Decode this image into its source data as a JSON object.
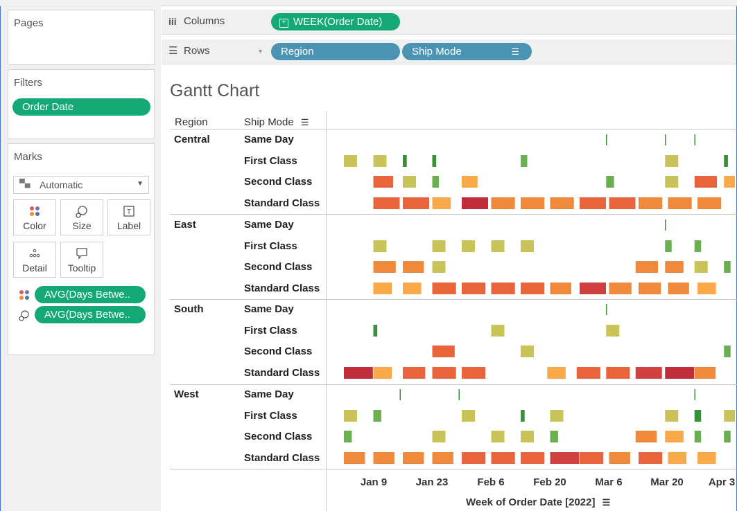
{
  "pages_label": "Pages",
  "filters": {
    "title": "Filters",
    "pill": "Order Date"
  },
  "marks": {
    "title": "Marks",
    "type_select": "Automatic",
    "buttons": [
      "Color",
      "Size",
      "Label",
      "Detail",
      "Tooltip"
    ],
    "pills": [
      "AVG(Days Betwe..",
      "AVG(Days Betwe.."
    ]
  },
  "columns_shelf": {
    "label": "Columns",
    "pill": "WEEK(Order Date)"
  },
  "rows_shelf": {
    "label": "Rows",
    "pills": [
      "Region",
      "Ship Mode"
    ]
  },
  "colors": {
    "pill_green": "#14a875",
    "pill_blue": "#4a93b3",
    "green": "#3a8f3a",
    "lightgreen": "#6aaf52",
    "yellowgreen": "#c9c45a",
    "lightorange": "#f9a84a",
    "orange": "#ef8a3c",
    "orangered": "#e8653c",
    "red": "#cf4040",
    "darkred": "#bf2d3b"
  },
  "chart_data": {
    "type": "gantt",
    "title": "Gantt Chart",
    "row_headers": {
      "region": "Region",
      "ship_mode": "Ship Mode"
    },
    "regions": [
      {
        "name": "Central",
        "rows": [
          {
            "ship_mode": "Same Day",
            "marks": [
              [
                8.9,
                0,
                "green"
              ],
              [
                10.9,
                0,
                "green"
              ],
              [
                11.9,
                0,
                "green"
              ]
            ]
          },
          {
            "ship_mode": "First Class",
            "marks": [
              [
                0,
                1,
                "yellowgreen"
              ],
              [
                1,
                1,
                "yellowgreen"
              ],
              [
                2,
                0.3,
                "green"
              ],
              [
                3,
                0.3,
                "green"
              ],
              [
                6,
                0.5,
                "lightgreen"
              ],
              [
                10.9,
                1,
                "yellowgreen"
              ],
              [
                12.9,
                0.3,
                "green"
              ]
            ]
          },
          {
            "ship_mode": "Second Class",
            "marks": [
              [
                1,
                1.5,
                "orangered"
              ],
              [
                2,
                1,
                "yellowgreen"
              ],
              [
                3,
                0.5,
                "lightgreen"
              ],
              [
                4,
                1.2,
                "lightorange"
              ],
              [
                8.9,
                0.6,
                "lightgreen"
              ],
              [
                10.9,
                1,
                "yellowgreen"
              ],
              [
                11.9,
                1.7,
                "orangered"
              ],
              [
                12.9,
                1.2,
                "lightorange"
              ]
            ]
          },
          {
            "ship_mode": "Standard Class",
            "marks": [
              [
                1,
                2,
                "orangered"
              ],
              [
                2,
                2,
                "orangered"
              ],
              [
                3,
                1.4,
                "lightorange"
              ],
              [
                4,
                2,
                "darkred"
              ],
              [
                5,
                1.8,
                "orange"
              ],
              [
                6,
                1.8,
                "orange"
              ],
              [
                7,
                1.8,
                "orange"
              ],
              [
                8,
                2,
                "orangered"
              ],
              [
                9,
                2,
                "orangered"
              ],
              [
                10,
                1.8,
                "orange"
              ],
              [
                11,
                1.8,
                "orange"
              ],
              [
                12,
                1.8,
                "orange"
              ]
            ]
          }
        ]
      },
      {
        "name": "East",
        "rows": [
          {
            "ship_mode": "Same Day",
            "marks": [
              [
                10.9,
                0,
                "green"
              ]
            ]
          },
          {
            "ship_mode": "First Class",
            "marks": [
              [
                1,
                1,
                "yellowgreen"
              ],
              [
                3,
                1,
                "yellowgreen"
              ],
              [
                4,
                1,
                "yellowgreen"
              ],
              [
                5,
                1,
                "yellowgreen"
              ],
              [
                6,
                1,
                "yellowgreen"
              ],
              [
                10.9,
                0.5,
                "lightgreen"
              ],
              [
                11.9,
                0.5,
                "lightgreen"
              ]
            ]
          },
          {
            "ship_mode": "Second Class",
            "marks": [
              [
                1,
                1.7,
                "orange"
              ],
              [
                2,
                1.6,
                "orange"
              ],
              [
                3,
                1,
                "yellowgreen"
              ],
              [
                9.9,
                1.7,
                "orange"
              ],
              [
                10.9,
                1.4,
                "orange"
              ],
              [
                11.9,
                1,
                "yellowgreen"
              ],
              [
                12.9,
                0.5,
                "lightgreen"
              ]
            ]
          },
          {
            "ship_mode": "Standard Class",
            "marks": [
              [
                1,
                1.4,
                "lightorange"
              ],
              [
                2,
                1.4,
                "lightorange"
              ],
              [
                3,
                1.8,
                "orangered"
              ],
              [
                4,
                1.8,
                "orangered"
              ],
              [
                5,
                1.8,
                "orangered"
              ],
              [
                6,
                1.8,
                "orangered"
              ],
              [
                7,
                1.6,
                "orange"
              ],
              [
                8,
                2,
                "red"
              ],
              [
                9,
                1.7,
                "orange"
              ],
              [
                10,
                1.7,
                "orange"
              ],
              [
                11,
                1.6,
                "orange"
              ],
              [
                12,
                1.4,
                "lightorange"
              ]
            ]
          }
        ]
      },
      {
        "name": "South",
        "rows": [
          {
            "ship_mode": "Same Day",
            "marks": [
              [
                8.9,
                0,
                "green"
              ]
            ]
          },
          {
            "ship_mode": "First Class",
            "marks": [
              [
                1,
                0.3,
                "green"
              ],
              [
                5,
                1,
                "yellowgreen"
              ],
              [
                8.9,
                1,
                "yellowgreen"
              ]
            ]
          },
          {
            "ship_mode": "Second Class",
            "marks": [
              [
                3,
                1.7,
                "orangered"
              ],
              [
                6,
                1,
                "yellowgreen"
              ],
              [
                12.9,
                0.5,
                "lightgreen"
              ]
            ]
          },
          {
            "ship_mode": "Standard Class",
            "marks": [
              [
                0,
                2.2,
                "darkred"
              ],
              [
                1,
                1.4,
                "lightorange"
              ],
              [
                2,
                1.7,
                "orangered"
              ],
              [
                3,
                1.8,
                "orangered"
              ],
              [
                4,
                1.8,
                "orangered"
              ],
              [
                6.9,
                1.4,
                "lightorange"
              ],
              [
                7.9,
                1.8,
                "orangered"
              ],
              [
                8.9,
                1.8,
                "orangered"
              ],
              [
                9.9,
                2,
                "red"
              ],
              [
                10.9,
                2.2,
                "darkred"
              ],
              [
                11.9,
                1.6,
                "orange"
              ]
            ]
          }
        ]
      },
      {
        "name": "West",
        "rows": [
          {
            "ship_mode": "Same Day",
            "marks": [
              [
                1.9,
                0,
                "green"
              ],
              [
                3.9,
                0,
                "green"
              ],
              [
                11.9,
                0,
                "green"
              ]
            ]
          },
          {
            "ship_mode": "First Class",
            "marks": [
              [
                0,
                1,
                "yellowgreen"
              ],
              [
                1,
                0.6,
                "lightgreen"
              ],
              [
                4,
                1,
                "yellowgreen"
              ],
              [
                6,
                0.3,
                "green"
              ],
              [
                7,
                1,
                "yellowgreen"
              ],
              [
                10.9,
                1,
                "yellowgreen"
              ],
              [
                11.9,
                0.5,
                "green"
              ],
              [
                12.9,
                1,
                "yellowgreen"
              ]
            ]
          },
          {
            "ship_mode": "Second Class",
            "marks": [
              [
                0,
                0.6,
                "lightgreen"
              ],
              [
                3,
                1,
                "yellowgreen"
              ],
              [
                5,
                1,
                "yellowgreen"
              ],
              [
                6,
                1,
                "yellowgreen"
              ],
              [
                7,
                0.6,
                "lightgreen"
              ],
              [
                9.9,
                1.6,
                "orange"
              ],
              [
                10.9,
                1.4,
                "lightorange"
              ],
              [
                11.9,
                0.5,
                "lightgreen"
              ],
              [
                12.9,
                0.5,
                "lightgreen"
              ]
            ]
          },
          {
            "ship_mode": "Standard Class",
            "marks": [
              [
                0,
                1.6,
                "orange"
              ],
              [
                1,
                1.6,
                "orange"
              ],
              [
                2,
                1.6,
                "orange"
              ],
              [
                3,
                1.6,
                "orange"
              ],
              [
                4,
                1.8,
                "orangered"
              ],
              [
                5,
                1.8,
                "orangered"
              ],
              [
                6,
                1.8,
                "orangered"
              ],
              [
                7,
                2.2,
                "red"
              ],
              [
                8,
                1.8,
                "orangered"
              ],
              [
                9,
                1.6,
                "orange"
              ],
              [
                10,
                1.8,
                "orangered"
              ],
              [
                11,
                1.4,
                "lightorange"
              ],
              [
                12,
                1.4,
                "lightorange"
              ]
            ]
          }
        ]
      }
    ],
    "x_ticks": [
      "Jan 9",
      "Jan 23",
      "Feb 6",
      "Feb 20",
      "Mar 6",
      "Mar 20",
      "Apr 3"
    ],
    "xlabel": "Week of Order Date [2022]"
  }
}
